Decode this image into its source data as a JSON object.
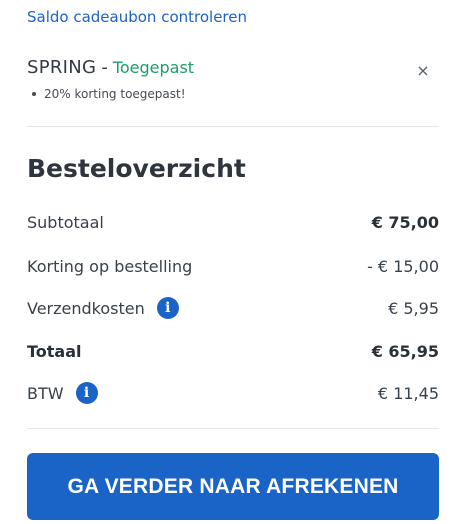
{
  "gift_card_link": "Saldo cadeaubon controleren",
  "coupon": {
    "code": "SPRING",
    "separator": "-",
    "status": "Toegepast",
    "detail": "20% korting toegepast!",
    "remove_icon": "close-icon",
    "remove_glyph": "×"
  },
  "summary": {
    "title": "Besteloverzicht",
    "rows": [
      {
        "label": "Subtotaal",
        "amount": "€ 75,00"
      },
      {
        "label": "Korting op bestelling",
        "amount": "- € 15,00"
      },
      {
        "label": "Verzendkosten",
        "amount": "€ 5,95"
      },
      {
        "label": "Totaal",
        "amount": "€ 65,95"
      },
      {
        "label": "BTW",
        "amount": "€ 11,45"
      }
    ],
    "info_glyph": "i"
  },
  "checkout_button": "GA VERDER NAAR AFREKENEN",
  "colors": {
    "accent": "#1a63c7",
    "applied": "#1f9d6b"
  }
}
